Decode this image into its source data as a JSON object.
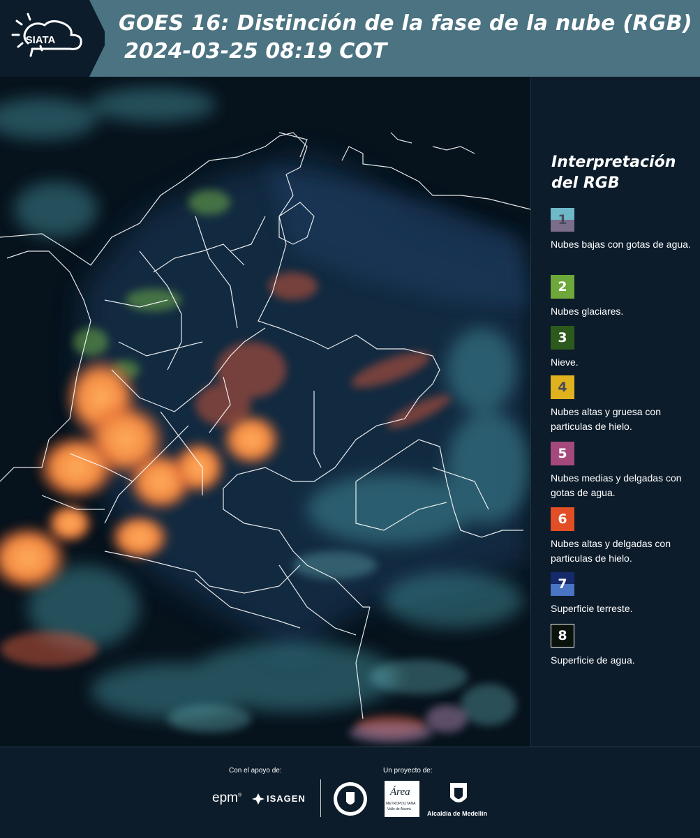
{
  "header": {
    "logo_text": "SIATA",
    "title": "GOES 16: Distinción de la fase de la nube (RGB)",
    "datetime": "2024-03-25 08:19 COT"
  },
  "legend": {
    "title_line1": "Interpretación",
    "title_line2": "del RGB",
    "items": [
      {
        "num": "1",
        "label": "Nubes bajas con gotas de agua.",
        "color_top": "#6fb8c8",
        "color_bottom": "#7b6d8c",
        "num_color": "#4a4a5a"
      },
      {
        "num": "2",
        "label": "Nubes glaciares.",
        "color": "#6ea83a",
        "num_color": "#ffffff"
      },
      {
        "num": "3",
        "label": "Nieve.",
        "color": "#2c5a1c",
        "num_color": "#ffffff"
      },
      {
        "num": "4",
        "label": "Nubes altas y gruesa con particulas de hielo.",
        "color": "#e0b21e",
        "num_color": "#4a4a5a"
      },
      {
        "num": "5",
        "label": "Nubes medias y delgadas con gotas de agua.",
        "color": "#a5497d",
        "num_color": "#ffffff"
      },
      {
        "num": "6",
        "label": "Nubes altas y delgadas con particulas de hielo.",
        "color": "#e24e25",
        "num_color": "#ffffff"
      },
      {
        "num": "7",
        "label": "Superficie terreste.",
        "color_top": "#142a6a",
        "color_bottom": "#4a74c4",
        "num_color": "#ffffff"
      },
      {
        "num": "8",
        "label": "Superficie de agua.",
        "color": "#0a120c",
        "num_color": "#ffffff",
        "border": "#ffffff"
      }
    ]
  },
  "footer": {
    "support_label": "Con el apoyo de:",
    "project_label": "Un proyecto de:",
    "epm_text": "epm",
    "isagen_text": "ISAGEN",
    "area_text": "Área",
    "area_sub1": "METROPOLITANA",
    "area_sub2": "Valle de Aburrá",
    "alcaldia_text": "Alcaldía de Medellín"
  }
}
